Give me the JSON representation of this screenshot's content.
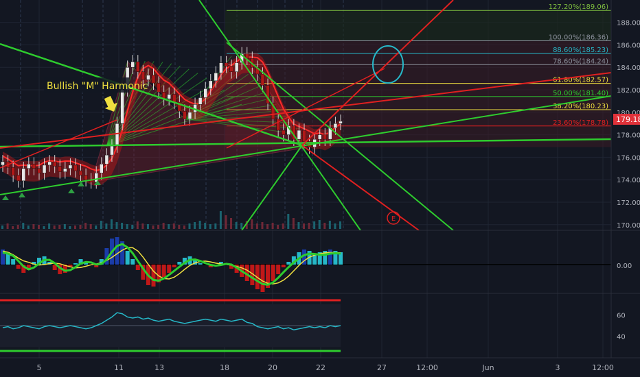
{
  "colors": {
    "background": "#131722",
    "grid": "#1f2533",
    "axis_text": "#b2b5be",
    "green": "#2ecc2e",
    "red": "#e02020",
    "yellow": "#f0e040",
    "cyan": "#26b8c8",
    "price_tag": "#e0323a"
  },
  "chart_data": [
    {
      "type": "candlestick",
      "title": "",
      "x_tick_labels": [
        "5",
        "11",
        "13",
        "18",
        "20",
        "22",
        "27",
        "12:00",
        "Jun",
        "3",
        "12:00"
      ],
      "y_axis_labels": [
        "188.00",
        "186.00",
        "184.00",
        "182.00",
        "180.00",
        "178.00",
        "176.00",
        "174.00",
        "172.00",
        "170.00"
      ],
      "ylim": [
        169.5,
        189.5
      ],
      "last_price": "179.18",
      "annotation": "Bullish \"M\" Harmonic",
      "marker_label": "E",
      "fibonacci_levels": [
        {
          "label": "127.20%(189.06)",
          "value": 189.06,
          "color": "#7fbf3f"
        },
        {
          "label": "100.00%(186.36)",
          "value": 186.36,
          "color": "#8a8f9a"
        },
        {
          "label": "88.60%(185.23)",
          "value": 185.23,
          "color": "#26b8c8"
        },
        {
          "label": "78.60%(184.24)",
          "value": 184.24,
          "color": "#8a8f9a"
        },
        {
          "label": "61.80%(182.57)",
          "value": 182.57,
          "color": "#f0e040"
        },
        {
          "label": "50.00%(181.40)",
          "value": 181.4,
          "color": "#2ecc2e"
        },
        {
          "label": "38.20%(180.23)",
          "value": 180.23,
          "color": "#f0e040"
        },
        {
          "label": "23.60%(178.78)",
          "value": 178.78,
          "color": "#e02020"
        }
      ],
      "price_series": [
        175.6,
        175.1,
        174.4,
        173.9,
        175.0,
        175.4,
        175.0,
        174.6,
        175.3,
        175.6,
        175.2,
        174.7,
        175.0,
        175.3,
        174.8,
        174.4,
        174.0,
        173.8,
        174.6,
        175.4,
        176.2,
        177.0,
        179.0,
        182.0,
        184.0,
        184.5,
        183.6,
        182.9,
        183.3,
        182.6,
        181.8,
        181.2,
        181.6,
        180.9,
        180.1,
        179.4,
        180.0,
        180.7,
        181.3,
        182.1,
        182.8,
        183.5,
        184.4,
        184.1,
        183.6,
        184.4,
        185.2,
        184.8,
        184.0,
        183.4,
        182.4,
        180.8,
        179.4,
        178.4,
        178.0,
        178.8,
        177.6,
        178.4,
        177.4,
        176.9,
        177.6,
        178.0,
        177.6,
        178.6,
        179.0,
        179.2
      ]
    },
    {
      "type": "bar",
      "title": "",
      "zero_label": "0.00",
      "histogram": [
        0.55,
        0.45,
        0.2,
        -0.15,
        -0.3,
        -0.2,
        0.1,
        0.25,
        0.3,
        0.1,
        -0.2,
        -0.35,
        -0.3,
        -0.1,
        0.05,
        0.2,
        0.1,
        0.0,
        -0.1,
        0.2,
        0.6,
        0.95,
        1.0,
        0.85,
        0.5,
        0.2,
        -0.2,
        -0.55,
        -0.75,
        -0.8,
        -0.65,
        -0.45,
        -0.3,
        -0.1,
        0.1,
        0.25,
        0.3,
        0.15,
        0.05,
        0.0,
        -0.1,
        -0.05,
        0.1,
        0.05,
        -0.15,
        -0.3,
        -0.45,
        -0.6,
        -0.75,
        -0.9,
        -1.0,
        -0.85,
        -0.6,
        -0.35,
        -0.1,
        0.1,
        0.3,
        0.45,
        0.55,
        0.5,
        0.4,
        0.45,
        0.5,
        0.55,
        0.5,
        0.45
      ]
    },
    {
      "type": "line",
      "title": "",
      "y_axis_labels": [
        "60",
        "40"
      ],
      "ylim": [
        20,
        80
      ],
      "series": [
        {
          "values": [
            48,
            49,
            47,
            48,
            50,
            49,
            48,
            47,
            49,
            50,
            49,
            48,
            49,
            50,
            49,
            48,
            47,
            48,
            50,
            52,
            55,
            58,
            62,
            61,
            58,
            57,
            58,
            56,
            57,
            55,
            54,
            55,
            56,
            54,
            53,
            52,
            53,
            54,
            55,
            56,
            55,
            54,
            56,
            55,
            54,
            55,
            56,
            53,
            52,
            49,
            48,
            47,
            48,
            49,
            47,
            48,
            46,
            47,
            48,
            49,
            48,
            49,
            48,
            50,
            49,
            50
          ]
        }
      ]
    }
  ]
}
